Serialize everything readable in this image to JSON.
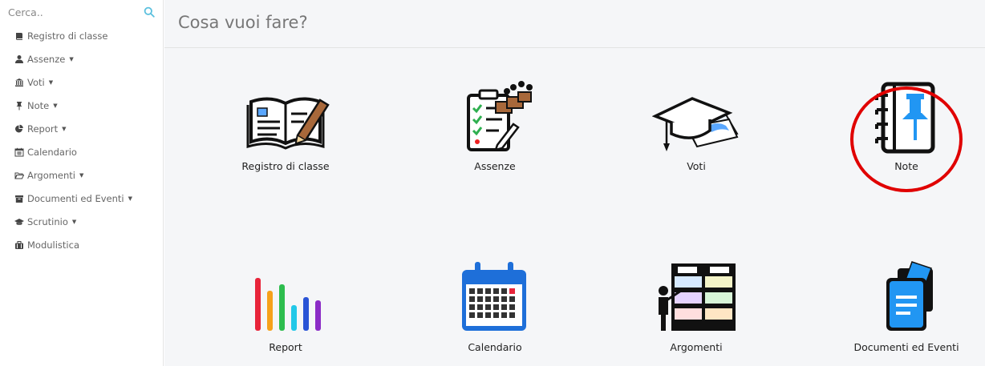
{
  "search": {
    "placeholder": "Cerca..",
    "icon": "search-icon"
  },
  "sidebar": {
    "items": [
      {
        "label": "Registro di classe",
        "icon": "book-icon",
        "caret": ""
      },
      {
        "label": "Assenze",
        "icon": "user-icon",
        "caret": "▼"
      },
      {
        "label": "Voti",
        "icon": "institution-icon",
        "caret": "▼"
      },
      {
        "label": "Note",
        "icon": "pushpin-icon",
        "caret": "▼"
      },
      {
        "label": "Report",
        "icon": "pie-chart-icon",
        "caret": "▼"
      },
      {
        "label": "Calendario",
        "icon": "calendar-icon",
        "caret": ""
      },
      {
        "label": "Argomenti",
        "icon": "folder-open-icon",
        "caret": "▼"
      },
      {
        "label": "Documenti ed Eventi",
        "icon": "archive-icon",
        "caret": "▼"
      },
      {
        "label": "Scrutinio",
        "icon": "graduation-cap-icon",
        "caret": "▼"
      },
      {
        "label": "Modulistica",
        "icon": "briefcase-icon",
        "caret": ""
      }
    ]
  },
  "main": {
    "title": "Cosa vuoi fare?",
    "tiles": [
      {
        "label": "Registro di classe",
        "icon": "open-book-pencil-icon"
      },
      {
        "label": "Assenze",
        "icon": "clipboard-checklist-icon"
      },
      {
        "label": "Voti",
        "icon": "graduation-cap-papers-icon"
      },
      {
        "label": "Note",
        "icon": "notebook-pushpin-icon"
      },
      {
        "label": "Report",
        "icon": "bar-chart-icon"
      },
      {
        "label": "Calendario",
        "icon": "calendar-icon"
      },
      {
        "label": "Argomenti",
        "icon": "teacher-shelves-icon"
      },
      {
        "label": "Documenti ed Eventi",
        "icon": "documents-icon"
      }
    ]
  },
  "colors": {
    "highlight": "#e00000",
    "accent": "#2196f3",
    "search_icon": "#5bc0de"
  }
}
